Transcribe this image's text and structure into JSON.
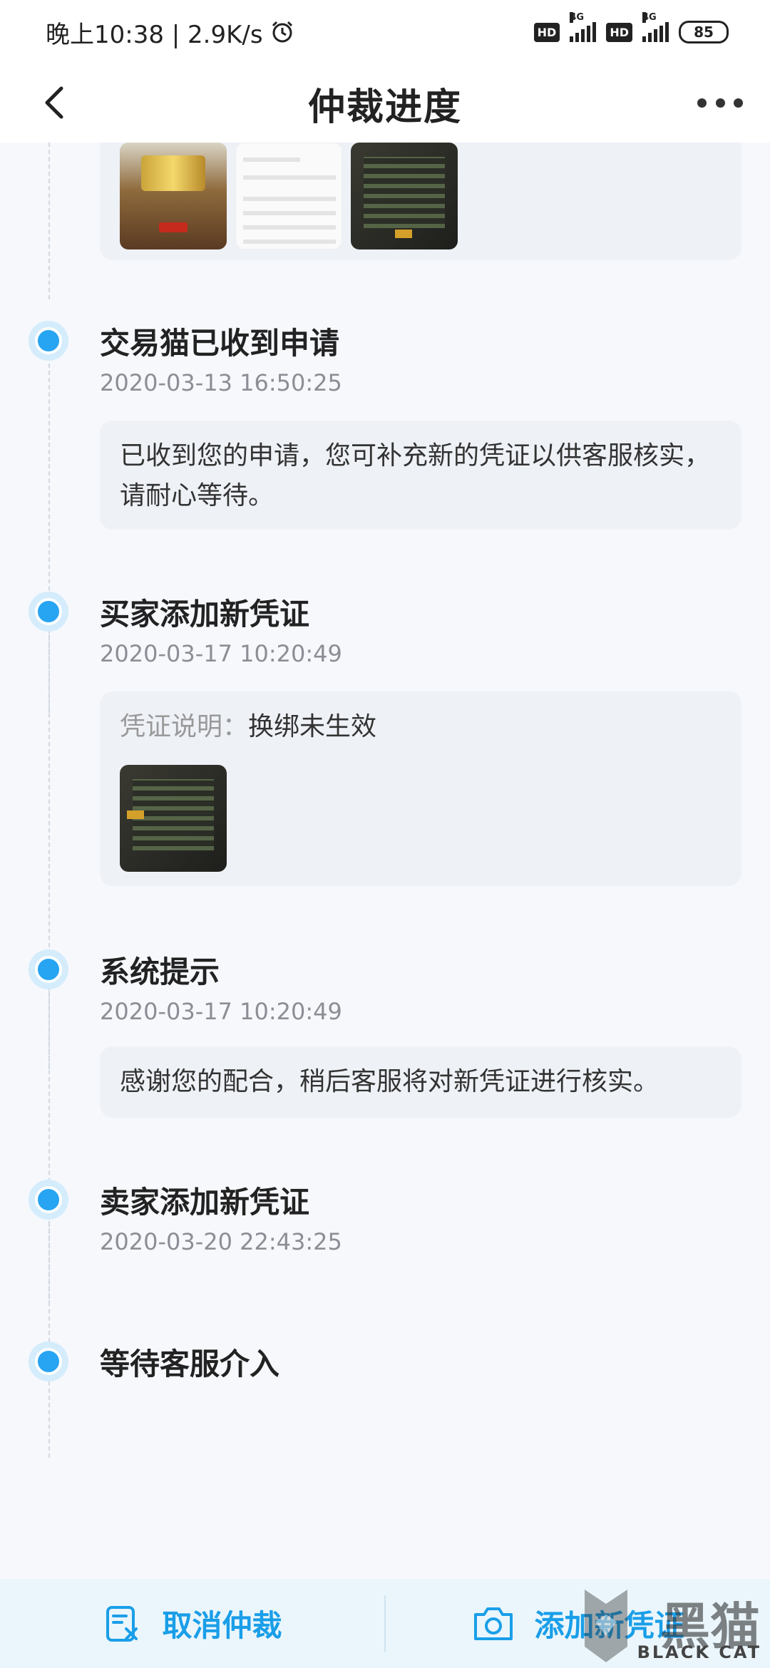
{
  "status_bar": {
    "time_speed": "晚上10:38 | 2.9K/s",
    "hd1": "HD",
    "net1": "4G",
    "hd2": "HD",
    "net2": "4G",
    "battery": "85"
  },
  "header": {
    "title": "仲裁进度"
  },
  "timeline": [
    {
      "title": "交易猫已收到申请",
      "time": "2020-03-13 16:50:25",
      "text": "已收到您的申请，您可补充新的凭证以供客服核实，请耐心等待。"
    },
    {
      "title": "买家添加新凭证",
      "time": "2020-03-17 10:20:49",
      "desc_label": "凭证说明：",
      "desc_value": "换绑未生效"
    },
    {
      "title": "系统提示",
      "time": "2020-03-17 10:20:49",
      "text": "感谢您的配合，稍后客服将对新凭证进行核实。"
    },
    {
      "title": "卖家添加新凭证",
      "time": "2020-03-20 22:43:25"
    },
    {
      "title": "等待客服介入"
    }
  ],
  "bottom_bar": {
    "cancel_label": "取消仲裁",
    "add_label": "添加新凭证"
  },
  "watermark": {
    "big": "黑猫",
    "small": "BLACK CAT"
  },
  "colors": {
    "accent": "#1a9ee8",
    "dot": "#27a4f2",
    "card_bg": "#eef1f6"
  }
}
